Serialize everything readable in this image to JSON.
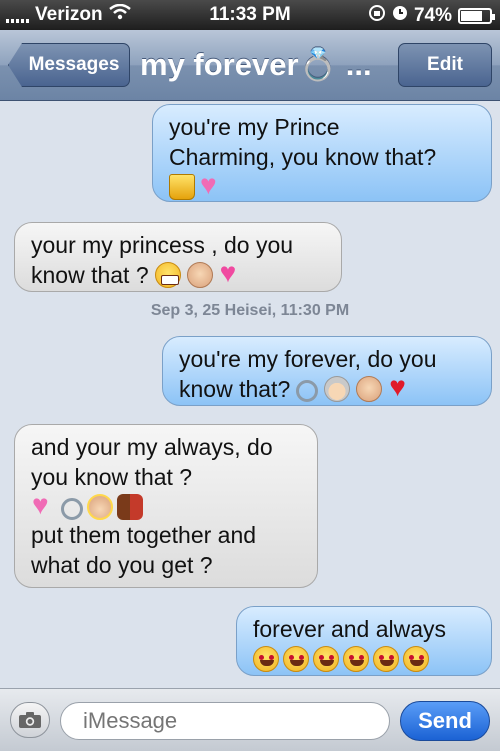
{
  "status": {
    "carrier": "Verizon",
    "time": "11:33 PM",
    "battery": "74%"
  },
  "nav": {
    "back_label": "Messages",
    "title": "my forever💍 ...",
    "edit_label": "Edit"
  },
  "messages": [
    {
      "from": "me",
      "lines": [
        "you're my Prince",
        "Charming, you know that?"
      ],
      "emoji": [
        "crown-icon",
        "two-hearts-icon"
      ]
    },
    {
      "from": "them",
      "lines": [
        "your my princess , do you",
        "know that ?"
      ],
      "emoji": [
        "grin-icon",
        "princess-icon",
        "sparkling-heart-icon"
      ]
    },
    {
      "from": "me",
      "lines": [
        "you're my forever, do you",
        "know that?"
      ],
      "emoji": [
        "ring-icon",
        "old-woman-icon",
        "old-man-icon",
        "red-heart-icon"
      ]
    },
    {
      "from": "them",
      "lines": [
        "and your my always, do",
        "you know that ?",
        "put them together and",
        "what do you get ?"
      ],
      "emoji": [
        "two-hearts-icon",
        "ring-icon",
        "angel-icon",
        "family-icon"
      ]
    },
    {
      "from": "me",
      "lines": [
        "forever and always"
      ],
      "emoji": [
        "heart-eyes-icon",
        "heart-eyes-icon",
        "heart-eyes-icon",
        "heart-eyes-icon",
        "heart-eyes-icon",
        "heart-eyes-icon"
      ]
    }
  ],
  "timestamp": "Sep 3, 25 Heisei, 11:30 PM",
  "input": {
    "placeholder": "iMessage",
    "send_label": "Send"
  }
}
